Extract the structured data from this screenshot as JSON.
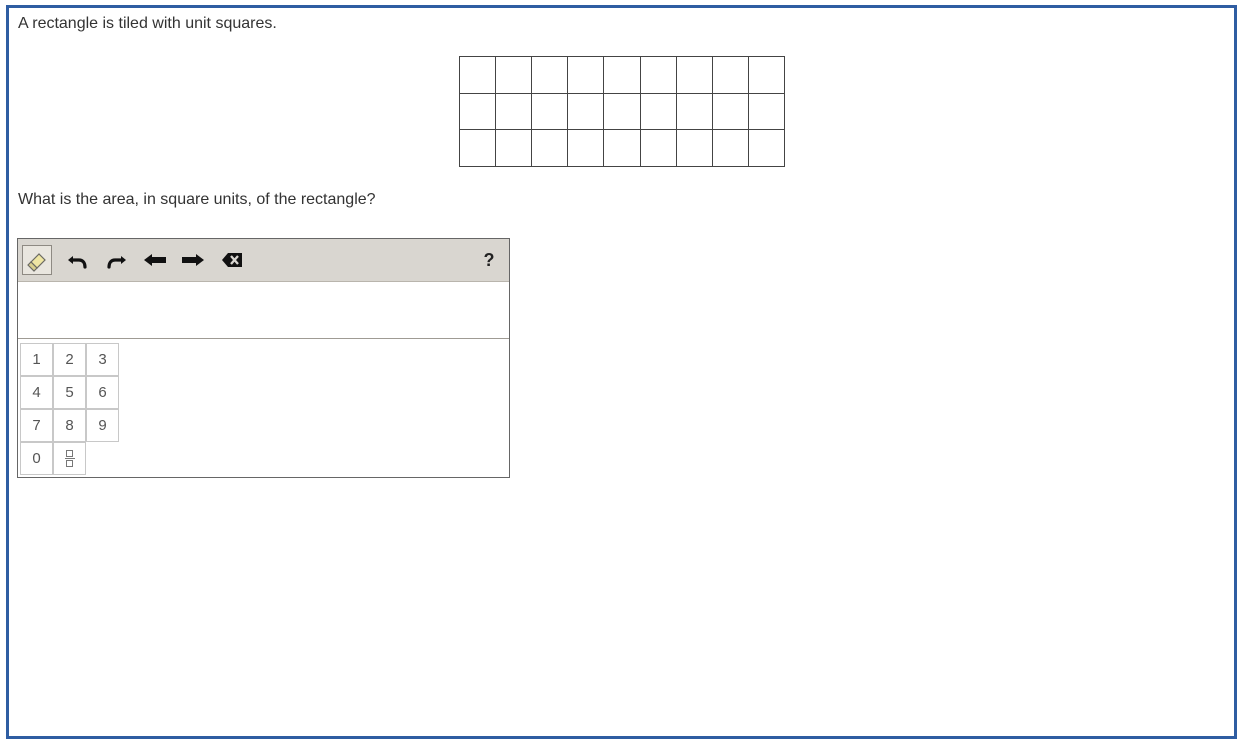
{
  "prompt": "A rectangle is tiled with unit squares.",
  "question": "What is the area, in square units, of the rectangle?",
  "tiling": {
    "columns": 9,
    "rows": 3
  },
  "toolbar": {
    "tools": [
      {
        "name": "eraser",
        "icon": "eraser-icon"
      },
      {
        "name": "undo",
        "icon": "undo-icon"
      },
      {
        "name": "redo",
        "icon": "redo-icon"
      },
      {
        "name": "move-left",
        "icon": "arrow-left-icon"
      },
      {
        "name": "move-right",
        "icon": "arrow-right-icon"
      },
      {
        "name": "backspace",
        "icon": "backspace-icon"
      }
    ],
    "help_label": "?"
  },
  "answer": {
    "value": ""
  },
  "keypad": {
    "keys": [
      "1",
      "2",
      "3",
      "4",
      "5",
      "6",
      "7",
      "8",
      "9",
      "0"
    ],
    "fraction_icon": "fraction-icon"
  }
}
